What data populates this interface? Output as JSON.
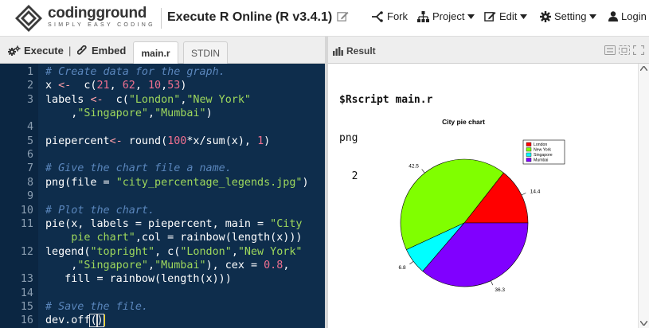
{
  "header": {
    "brand_name": "codingground",
    "brand_tagline": "SIMPLY EASY CODING",
    "page_title": "Execute R Online (R v3.4.1)",
    "nav": {
      "fork": "Fork",
      "project": "Project",
      "edit": "Edit",
      "setting": "Setting",
      "login": "Login"
    }
  },
  "toolbar": {
    "execute": "Execute",
    "separator": "|",
    "embed": "Embed",
    "tabs": [
      {
        "label": "main.r",
        "active": true
      },
      {
        "label": "STDIN",
        "active": false
      }
    ]
  },
  "editor": {
    "line_numbers": [
      "1",
      "2",
      "3",
      "",
      "4",
      "5",
      "6",
      "7",
      "8",
      "9",
      "10",
      "11",
      "",
      "12",
      "",
      "13",
      "14",
      "15",
      "16"
    ],
    "colors": {
      "background": "#0e2d4c",
      "comment": "#5a86bc",
      "string": "#9ed85c",
      "number": "#f07090"
    }
  },
  "result": {
    "title": "Result",
    "output_lines": [
      "$Rscript main.r",
      "png",
      "  2"
    ]
  },
  "chart_data": {
    "type": "pie",
    "title": "City pie chart",
    "categories": [
      "London",
      "New York",
      "Singapore",
      "Mumbai"
    ],
    "values": [
      14.4,
      42.5,
      6.8,
      36.3
    ],
    "slice_labels": [
      "14.4",
      "42.5",
      "6.8",
      "36.3"
    ],
    "colors": [
      "#ff0000",
      "#80ff00",
      "#00ffff",
      "#8000ff"
    ],
    "legend": {
      "placement": "top-right",
      "entries": [
        "London",
        "New York",
        "Singapore",
        "Mumbai"
      ]
    }
  }
}
